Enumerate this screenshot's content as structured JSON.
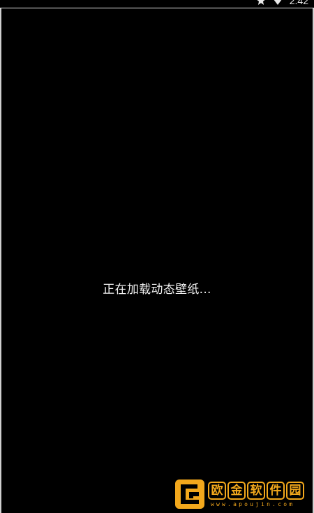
{
  "status_bar": {
    "time": "2:42",
    "icons": [
      "star-icon",
      "wifi-icon"
    ]
  },
  "screen": {
    "loading_text": "正在加载动态壁纸..."
  },
  "watermark": {
    "brand_chars": [
      "欧",
      "金",
      "软",
      "件",
      "园"
    ],
    "url": "www.apoujin.com",
    "accent_color": "#f3a81c"
  }
}
